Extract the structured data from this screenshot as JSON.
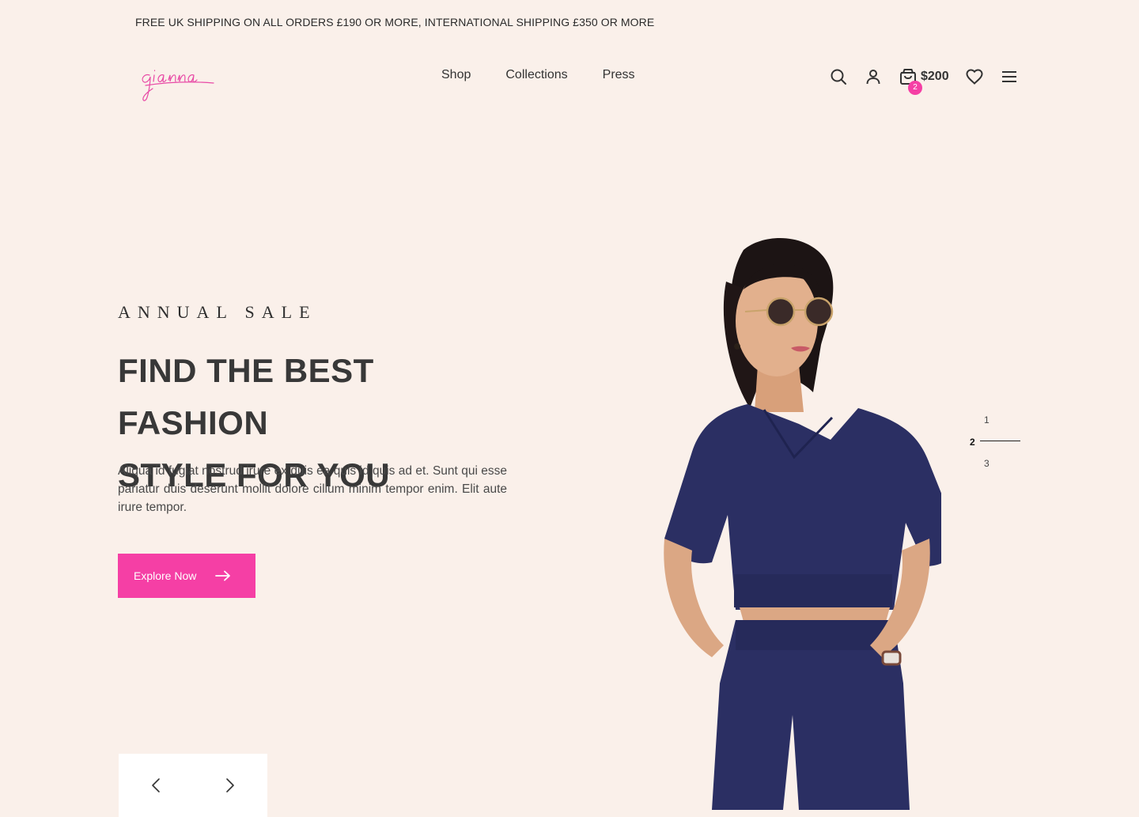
{
  "topbar": {
    "text": "FREE UK SHIPPING ON ALL ORDERS £190 OR MORE, INTERNATIONAL SHIPPING £350 OR MORE"
  },
  "brand": {
    "logo_text": "gianna",
    "accent": "#f53fa5"
  },
  "nav": {
    "items": [
      "Shop",
      "Collections",
      "Press"
    ]
  },
  "header_icons": {
    "search": "search-icon",
    "account": "user-icon",
    "cart": {
      "icon": "shopping-bag-icon",
      "count": "2",
      "total": "$200"
    },
    "wishlist": "heart-icon",
    "menu": "hamburger-menu-icon"
  },
  "hero": {
    "eyebrow": "ANNUAL SALE",
    "title_line1": "FIND THE BEST FASHION",
    "title_line2": "STYLE FOR YOU",
    "description": "Aliqua id fugiat nostrud irure ex duis ea quis id quis ad et. Sunt qui esse pariatur duis deserunt mollit dolore cillum minim tempor enim. Elit aute irure tempor.",
    "cta_label": "Explore Now",
    "cta_icon": "arrow-right-icon"
  },
  "slider": {
    "prev_icon": "chevron-left-icon",
    "next_icon": "chevron-right-icon",
    "pages": [
      "1",
      "2",
      "3"
    ],
    "active_page": "2"
  },
  "colors": {
    "background": "#faf0ea",
    "text": "#333333",
    "accent": "#f53fa5",
    "outfit": "#2b2f63"
  }
}
